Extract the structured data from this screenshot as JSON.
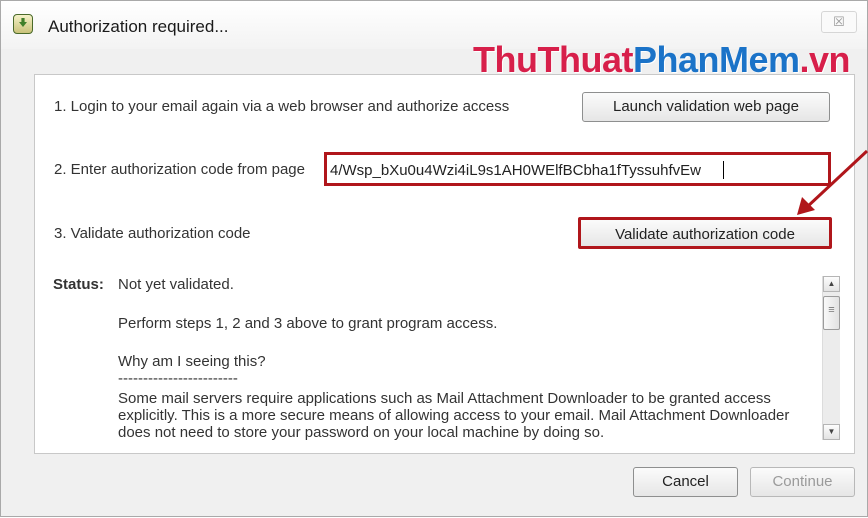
{
  "window": {
    "title": "Authorization required...",
    "close_icon_glyph": "☒"
  },
  "watermark": {
    "part1": "ThuThuat",
    "part2": "PhanMem",
    "part3": ".vn"
  },
  "steps": {
    "step1_label": "1. Login to your email again via a web browser and authorize access",
    "launch_button": "Launch validation web page",
    "step2_label": "2. Enter authorization code from page",
    "code_value": "4/Wsp_bXu0u4Wzi4iL9s1AH0WElfBCbha1fTyssuhfvEw",
    "step3_label": "3. Validate authorization code",
    "validate_button": "Validate authorization code"
  },
  "status": {
    "label": "Status:",
    "line1": "Not yet validated.",
    "line2": "Perform steps 1, 2 and 3 above to grant program access.",
    "line3": "Why am I seeing this?",
    "separator": "------------------------",
    "line4": "Some mail servers require applications such as Mail Attachment Downloader to be granted access explicitly. This is a more secure means of allowing access to your email. Mail Attachment Downloader does not need to store your password on your local machine by doing so."
  },
  "footer": {
    "cancel_button": "Cancel",
    "continue_button": "Continue"
  },
  "colors": {
    "highlight_red": "#b0161b",
    "watermark_red": "#d71f4a",
    "watermark_blue": "#1b73c8"
  }
}
